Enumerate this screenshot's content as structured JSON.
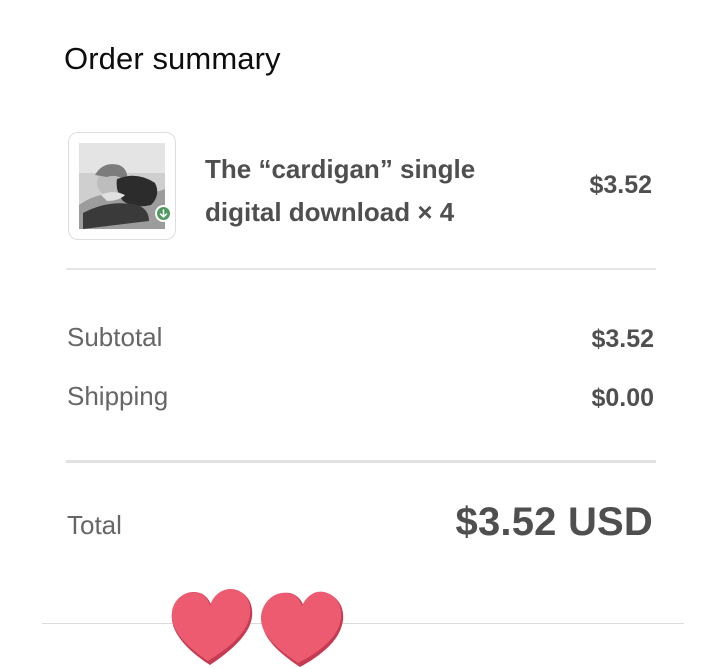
{
  "summary": {
    "heading": "Order summary"
  },
  "line_item": {
    "title_line1": "The “cardigan” single",
    "title_line2": "digital download × 4",
    "price": "$3.52",
    "badge_icon": "download-arrow-icon",
    "badge_color": "#4f9a60"
  },
  "totals": {
    "subtotal_label": "Subtotal",
    "subtotal_value": "$3.52",
    "shipping_label": "Shipping",
    "shipping_value": "$0.00",
    "total_label": "Total",
    "total_value": "$3.52 USD"
  },
  "decoration": {
    "hearts_icon": "two-hearts-icon",
    "heart_color": "#e8576b"
  }
}
